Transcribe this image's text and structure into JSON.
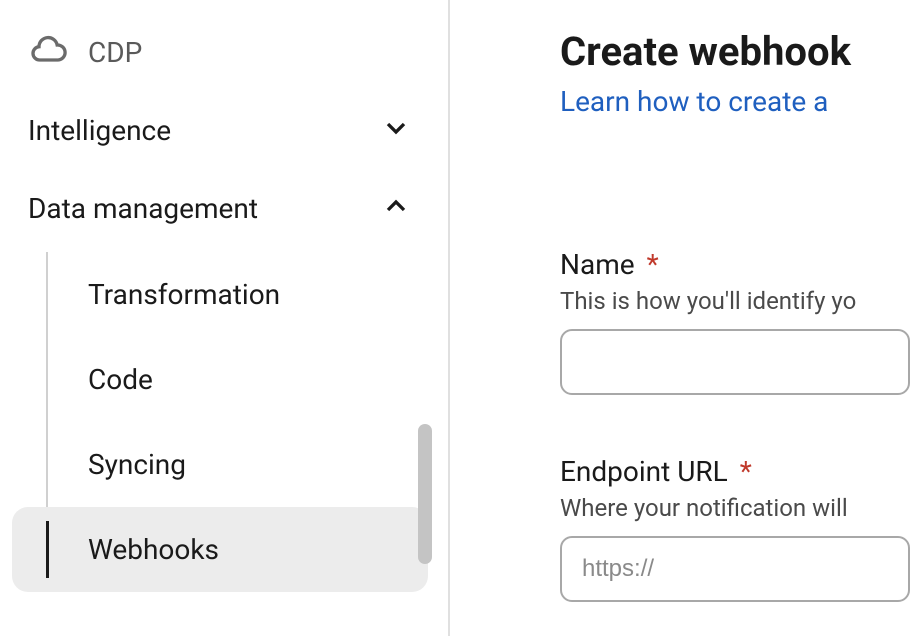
{
  "sidebar": {
    "cdp": {
      "label": "CDP"
    },
    "intelligence": {
      "label": "Intelligence"
    },
    "data_management": {
      "label": "Data management",
      "items": [
        {
          "label": "Transformation"
        },
        {
          "label": "Code"
        },
        {
          "label": "Syncing"
        },
        {
          "label": "Webhooks"
        }
      ]
    }
  },
  "main": {
    "title": "Create webhook",
    "learn_link": "Learn how to create a",
    "fields": {
      "name": {
        "label": "Name",
        "help": "This is how you'll identify yo",
        "value": "",
        "placeholder": ""
      },
      "endpoint": {
        "label": "Endpoint URL",
        "help": "Where your notification will ",
        "value": "",
        "placeholder": "https://"
      }
    }
  }
}
